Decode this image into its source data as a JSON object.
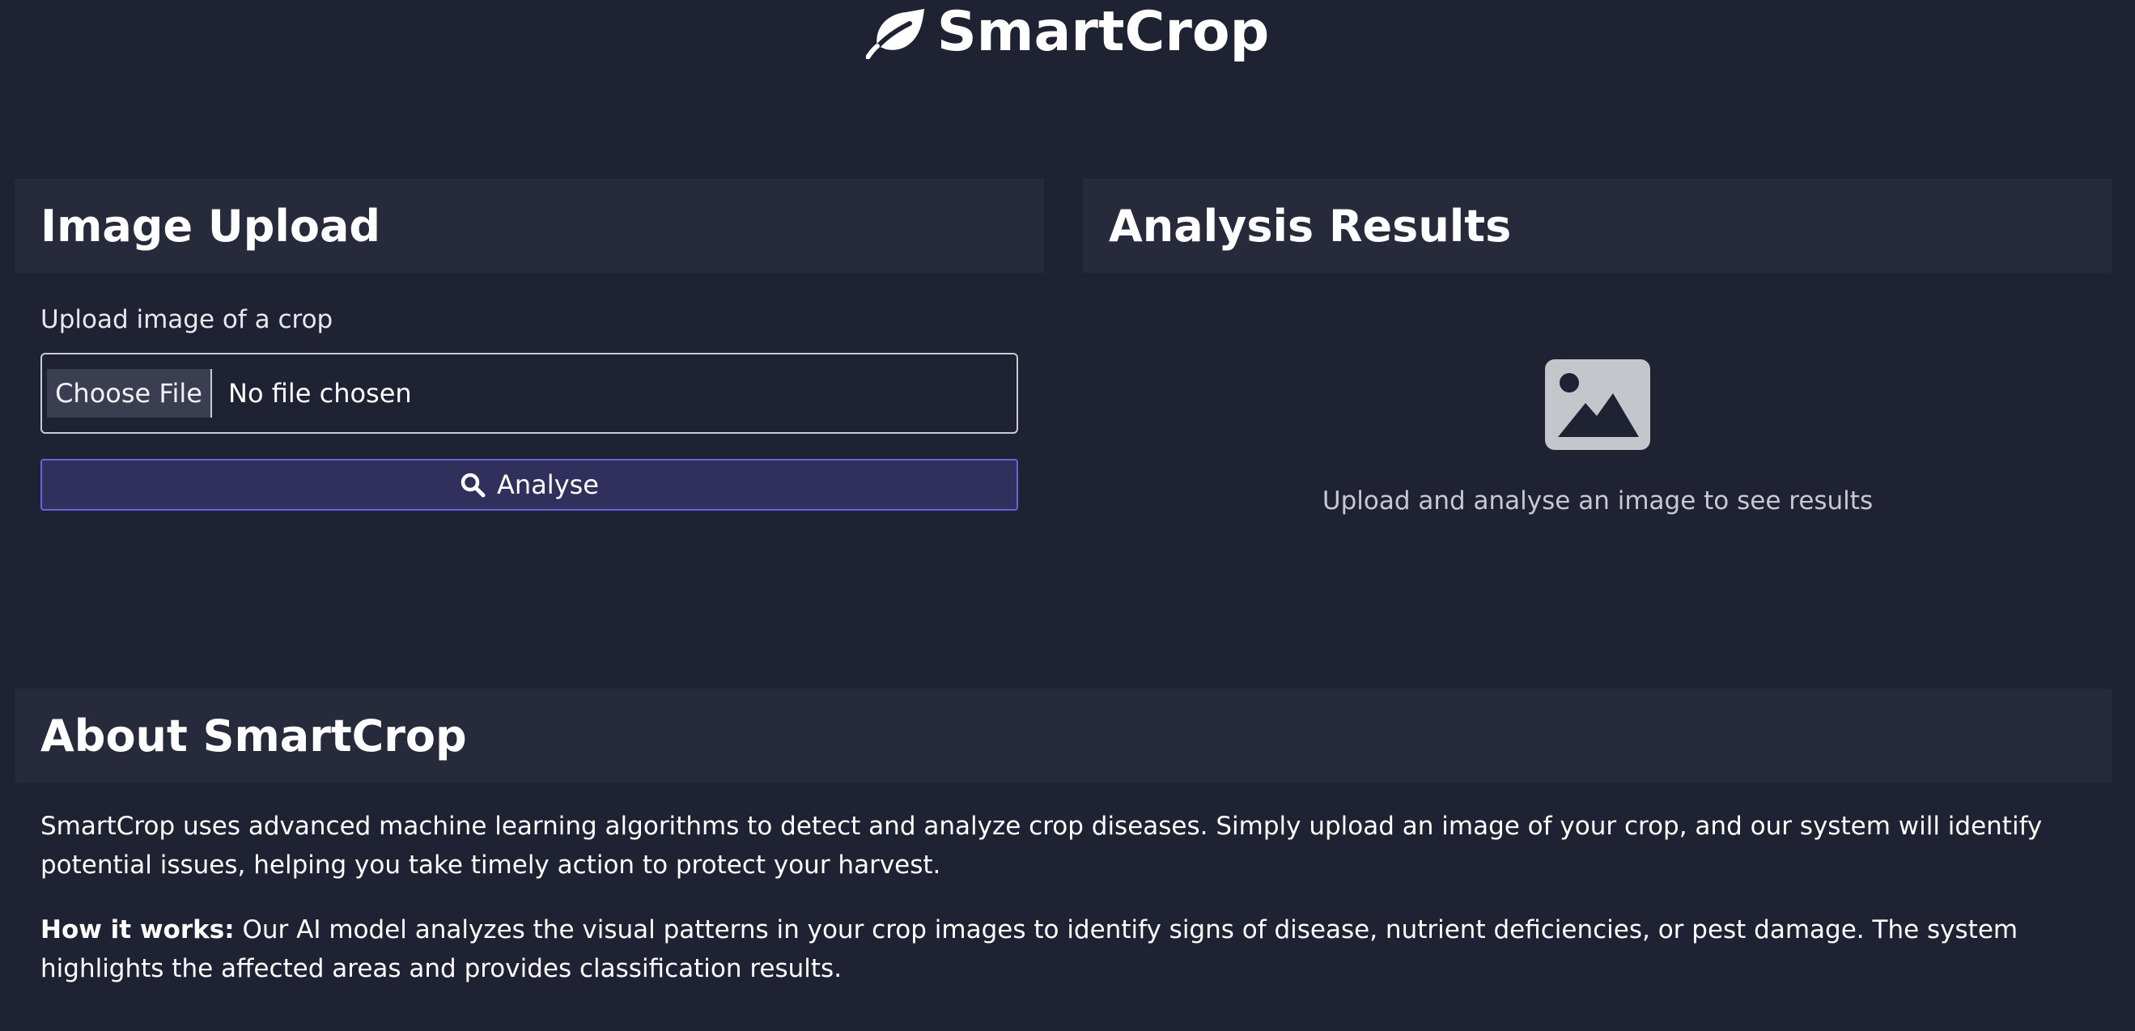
{
  "header": {
    "title": "SmartCrop",
    "icon": "leaf-icon"
  },
  "upload": {
    "heading": "Image Upload",
    "label": "Upload image of a crop",
    "choose_button": "Choose File",
    "file_status": "No file chosen",
    "analyse_button": "Analyse",
    "analyse_icon": "search-icon"
  },
  "results": {
    "heading": "Analysis Results",
    "placeholder_icon": "image-icon",
    "placeholder_text": "Upload and analyse an image to see results"
  },
  "about": {
    "heading": "About SmartCrop",
    "paragraph1": "SmartCrop uses advanced machine learning algorithms to detect and analyze crop diseases. Simply upload an image of your crop, and our system will identify potential issues, helping you take timely action to protect your harvest.",
    "how_label": "How it works:",
    "how_text": " Our AI model analyzes the visual patterns in your crop images to identify signs of disease, nutrient deficiencies, or pest damage. The system highlights the affected areas and provides classification results."
  },
  "colors": {
    "background": "#1f2233",
    "card_header": "#262a3b",
    "accent": "#6d5fe0",
    "button_fill": "#312f5c"
  }
}
